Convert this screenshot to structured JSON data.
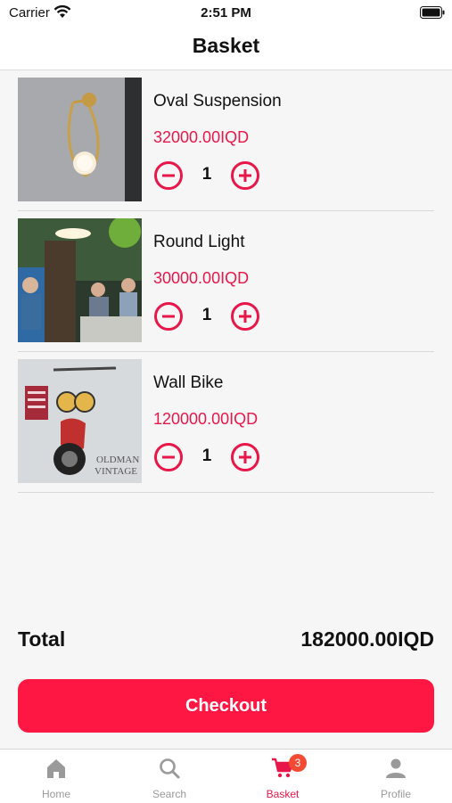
{
  "status_bar": {
    "carrier": "Carrier",
    "time": "2:51 PM"
  },
  "header": {
    "title": "Basket"
  },
  "items": [
    {
      "name": "Oval Suspension",
      "price": "32000.00IQD",
      "quantity": "1",
      "image": "wall-lamp-photo"
    },
    {
      "name": "Round Light",
      "price": "30000.00IQD",
      "quantity": "1",
      "image": "outdoor-light-photo"
    },
    {
      "name": "Wall Bike",
      "price": "120000.00IQD",
      "quantity": "1",
      "image": "wall-bike-photo"
    }
  ],
  "thumb_texts": {
    "bike_sign_1": "OLDMAN",
    "bike_sign_2": "VINTAGE"
  },
  "summary": {
    "total_label": "Total",
    "total_value": "182000.00IQD"
  },
  "checkout": {
    "label": "Checkout"
  },
  "tabbar": {
    "tabs": [
      {
        "label": "Home",
        "icon": "home-icon"
      },
      {
        "label": "Search",
        "icon": "search-icon"
      },
      {
        "label": "Basket",
        "icon": "cart-icon",
        "badge": "3"
      },
      {
        "label": "Profile",
        "icon": "profile-icon"
      }
    ]
  },
  "colors": {
    "accent": "#ff1744",
    "price": "#e8174a",
    "badge": "#f24a33",
    "inactive": "#9a9a9a"
  }
}
